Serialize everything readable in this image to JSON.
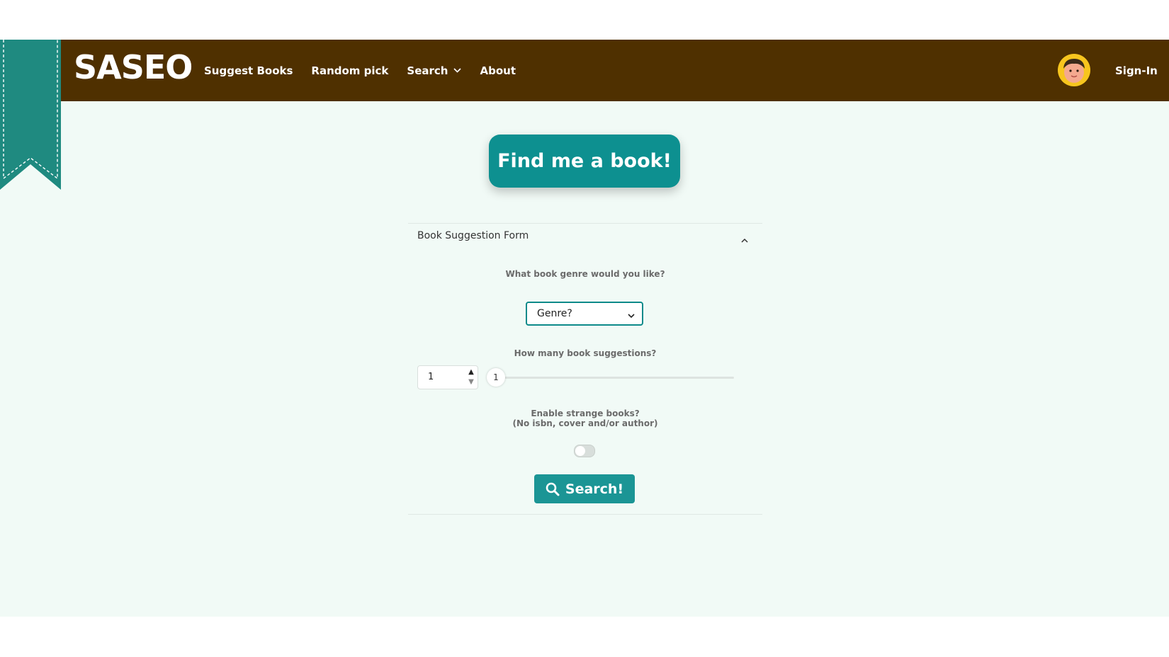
{
  "header": {
    "logo": "SASEO",
    "nav": [
      {
        "label": "Suggest Books"
      },
      {
        "label": "Random pick"
      },
      {
        "label": "Search",
        "icon": "chevron-down-icon"
      },
      {
        "label": "About"
      }
    ],
    "avatar_icon": "avatar-icon",
    "signin_label": "Sign-In"
  },
  "hero": {
    "button_label": "Find me a book!"
  },
  "form": {
    "title": "Book Suggestion Form",
    "collapse_icon": "chevron-up-icon",
    "genre_question": "What book genre would you like?",
    "genre_selected": "Genre?",
    "count_question": "How many book suggestions?",
    "count_value": "1",
    "slider_value": "1",
    "strange_question_line1": "Enable strange books?",
    "strange_question_line2": "(No isbn, cover and/or author)",
    "strange_enabled": false,
    "search_label": "Search!",
    "search_icon": "search-icon"
  },
  "colors": {
    "header_bg": "#4f3000",
    "accent_teal": "#0d9090",
    "page_bg": "#f1faf6",
    "ribbon": "#1f8a80"
  }
}
